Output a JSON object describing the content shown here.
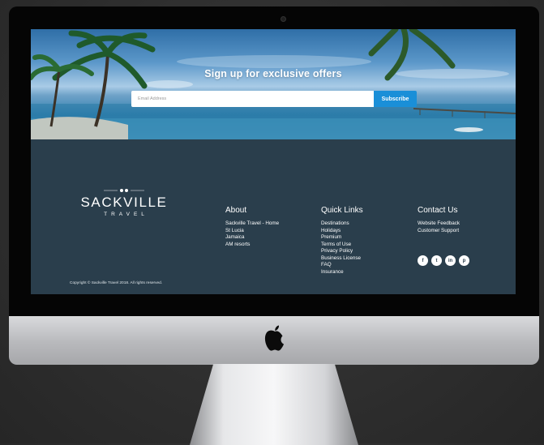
{
  "hero": {
    "title": "Sign up for exclusive offers",
    "email_placeholder": "Email Address",
    "subscribe_label": "Subscribe"
  },
  "brand": {
    "name": "SACKVILLE",
    "subtitle": "TRAVEL"
  },
  "footer": {
    "copyright": "Copyright © Sackville Travel 2018. All rights reserved.",
    "about": {
      "title": "About",
      "links": [
        "Sackville Travel - Home",
        "St Lucia",
        "Jamaica",
        "AM resorts"
      ]
    },
    "quick_links": {
      "title": "Quick Links",
      "links": [
        "Destinations",
        "Holidays",
        "Premium",
        "Terms of Use",
        "Privacy Policy",
        "Business License",
        "FAQ",
        "Insurance"
      ]
    },
    "contact": {
      "title": "Contact Us",
      "links": [
        "Website Feedback",
        "Customer Support"
      ]
    },
    "social": [
      {
        "icon": "facebook-icon",
        "glyph": "f"
      },
      {
        "icon": "twitter-icon",
        "glyph": "t"
      },
      {
        "icon": "linkedin-icon",
        "glyph": "in"
      },
      {
        "icon": "pinterest-icon",
        "glyph": "p"
      }
    ]
  },
  "colors": {
    "footer_bg": "#2a3e4c",
    "subscribe_button": "#1a8fd8",
    "device_frame": "#050505"
  }
}
